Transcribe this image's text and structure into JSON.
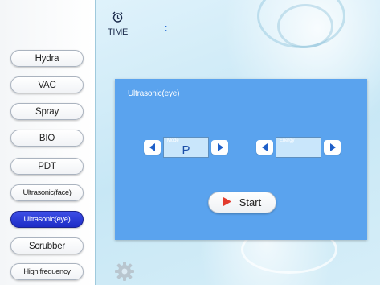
{
  "sidebar": {
    "items": [
      {
        "label": "Hydra",
        "active": false
      },
      {
        "label": "VAC",
        "active": false
      },
      {
        "label": "Spray",
        "active": false
      },
      {
        "label": "BIO",
        "active": false
      },
      {
        "label": "PDT",
        "active": false
      },
      {
        "label": "Ultrasonic(face)",
        "active": false
      },
      {
        "label": "Ultrasonic(eye)",
        "active": true
      },
      {
        "label": "Scrubber",
        "active": false
      },
      {
        "label": "High frequency",
        "active": false
      }
    ]
  },
  "header": {
    "time_icon": "alarm-clock-icon",
    "time_label": "TIME",
    "time_separator": ":"
  },
  "panel": {
    "title": "Ultrasonic(eye)",
    "mode": {
      "caption": "Mode",
      "value": "P"
    },
    "energy": {
      "caption": "Energy",
      "value": ""
    },
    "start_label": "Start"
  },
  "footer": {
    "settings_icon": "gear-icon"
  },
  "colors": {
    "active_button": "#2233d6",
    "panel_bg": "#5aa3ee",
    "play_icon": "#e23b2e"
  }
}
